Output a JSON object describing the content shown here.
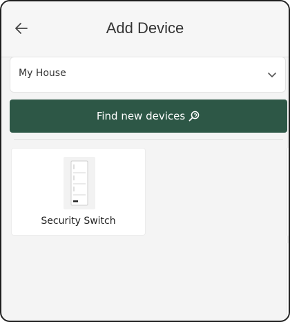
{
  "header": {
    "title": "Add Device",
    "back_icon": "arrow-left-icon"
  },
  "house_select": {
    "value": "My House",
    "icon": "chevron-down-icon"
  },
  "find_button": {
    "label": "Find new devices",
    "icon": "search-icon"
  },
  "devices": [
    {
      "name": "Security Switch",
      "icon": "wall-switch-icon"
    }
  ],
  "colors": {
    "accent": "#2d5746",
    "background": "#f4f4f4"
  }
}
